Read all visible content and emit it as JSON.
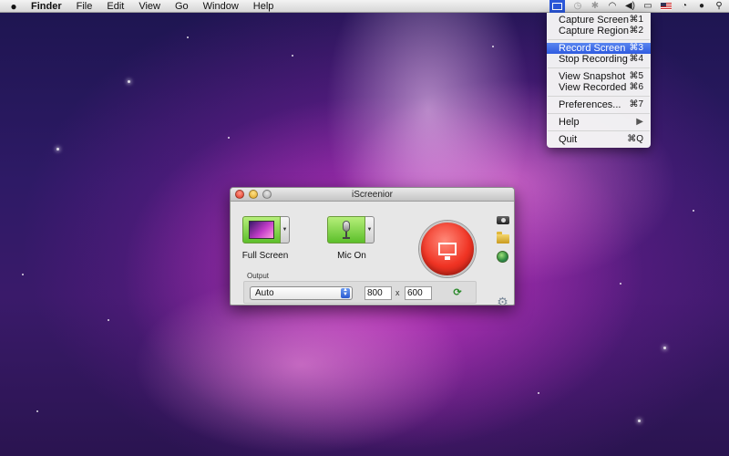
{
  "menubar": {
    "apple_icon": "",
    "items": [
      "Finder",
      "File",
      "Edit",
      "View",
      "Go",
      "Window",
      "Help"
    ],
    "status_icons": [
      "screen-recorder-icon",
      "time-machine-icon",
      "bluetooth-icon",
      "wifi-icon",
      "volume-icon",
      "battery-icon",
      "flag-icon",
      "clock-icon",
      "user-icon",
      "spotlight-icon"
    ]
  },
  "dropdown": {
    "groups": [
      [
        {
          "label": "Capture Screen",
          "shortcut": "⌘1"
        },
        {
          "label": "Capture Region",
          "shortcut": "⌘2"
        }
      ],
      [
        {
          "label": "Record Screen",
          "shortcut": "⌘3"
        },
        {
          "label": "Stop Recording",
          "shortcut": "⌘4"
        }
      ],
      [
        {
          "label": "View Snapshot",
          "shortcut": "⌘5"
        },
        {
          "label": "View Recorded",
          "shortcut": "⌘6"
        }
      ],
      [
        {
          "label": "Preferences...",
          "shortcut": "⌘7"
        }
      ],
      [
        {
          "label": "Help",
          "shortcut": "▶"
        }
      ],
      [
        {
          "label": "Quit",
          "shortcut": "⌘Q"
        }
      ]
    ],
    "selected": "Record Screen"
  },
  "window": {
    "title": "iScreenior",
    "full_screen_label": "Full Screen",
    "mic_label": "Mic On",
    "output_label": "Output",
    "output_select_value": "Auto",
    "width_value": "800",
    "height_value": "600",
    "times_symbol": "x"
  },
  "colors": {
    "record_red": "#f03424",
    "tool_green": "#5cbf2a",
    "menu_selection": "#2f5be0"
  }
}
